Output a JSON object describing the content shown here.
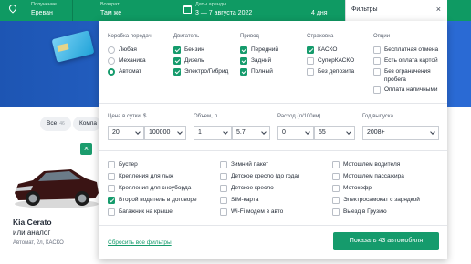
{
  "topbar": {
    "pickup": {
      "caption": "Получение",
      "value": "Ереван"
    },
    "dropoff": {
      "caption": "Возврат",
      "value": "Там же"
    },
    "dates": {
      "caption": "Даты аренды",
      "value": "3 — 7 августа 2022",
      "days": "4 дня"
    },
    "filters_label": "Фильтры",
    "close_symbol": "×"
  },
  "chips": [
    {
      "label": "Все",
      "count": "46"
    },
    {
      "label": "Компа"
    }
  ],
  "car": {
    "title": "Kia Cerato",
    "subtitle": "или аналог",
    "meta": "Автомат, 2л, КАСКО",
    "badge_icon": "close-icon"
  },
  "filters": {
    "transmission": {
      "title": "Коробка передач",
      "options": [
        {
          "label": "Любая",
          "selected": false
        },
        {
          "label": "Механика",
          "selected": false
        },
        {
          "label": "Автомат",
          "selected": true
        }
      ]
    },
    "engine": {
      "title": "Двигатель",
      "options": [
        {
          "label": "Бензин",
          "checked": true
        },
        {
          "label": "Дизель",
          "checked": true
        },
        {
          "label": "Электро/Гибрид",
          "checked": true
        }
      ]
    },
    "drive": {
      "title": "Привод",
      "options": [
        {
          "label": "Передний",
          "checked": true
        },
        {
          "label": "Задний",
          "checked": true
        },
        {
          "label": "Полный",
          "checked": true
        }
      ]
    },
    "insurance": {
      "title": "Страховка",
      "options": [
        {
          "label": "КАСКО",
          "checked": true
        },
        {
          "label": "СуперКАСКО",
          "checked": false
        },
        {
          "label": "Без депозита",
          "checked": false
        }
      ]
    },
    "options": {
      "title": "Опции",
      "options": [
        {
          "label": "Бесплатная отмена",
          "checked": false
        },
        {
          "label": "Есть оплата картой",
          "checked": false
        },
        {
          "label": "Без ограничения пробега",
          "checked": false
        },
        {
          "label": "Оплата наличными",
          "checked": false
        }
      ]
    },
    "price": {
      "title": "Цена в сутки, $",
      "from": "20",
      "to": "100000"
    },
    "volume": {
      "title": "Объем, л.",
      "from": "1",
      "to": "5.7"
    },
    "consumption": {
      "title": "Расход (л/100км)",
      "from": "0",
      "to": "55"
    },
    "year": {
      "title": "Год выпуска",
      "value": "2008+"
    },
    "extras": [
      [
        {
          "label": "Бустер",
          "checked": false
        },
        {
          "label": "Зимний пакет",
          "checked": false
        },
        {
          "label": "Мотошлем водителя",
          "checked": false
        }
      ],
      [
        {
          "label": "Крепления для лыж",
          "checked": false
        },
        {
          "label": "Детское кресло (до года)",
          "checked": false
        },
        {
          "label": "Мотошлем пассажира",
          "checked": false
        }
      ],
      [
        {
          "label": "Крепления для сноуборда",
          "checked": false
        },
        {
          "label": "Детское кресло",
          "checked": false
        },
        {
          "label": "Мотокофр",
          "checked": false
        }
      ],
      [
        {
          "label": "Второй водитель в договоре",
          "checked": true
        },
        {
          "label": "SIM-карта",
          "checked": false
        },
        {
          "label": "Электросамокат с зарядкой",
          "checked": false
        }
      ],
      [
        {
          "label": "Багажник на крыше",
          "checked": false
        },
        {
          "label": "Wi-Fi модем в авто",
          "checked": false
        },
        {
          "label": "Выезд в Грузию",
          "checked": false
        }
      ]
    ],
    "reset_label": "Сбросить все фильтры",
    "show_button": "Показать 43 автомобиля"
  },
  "colors": {
    "brand": "#159b6c",
    "topbar": "#0f9a63",
    "hero": "#2968cf"
  }
}
